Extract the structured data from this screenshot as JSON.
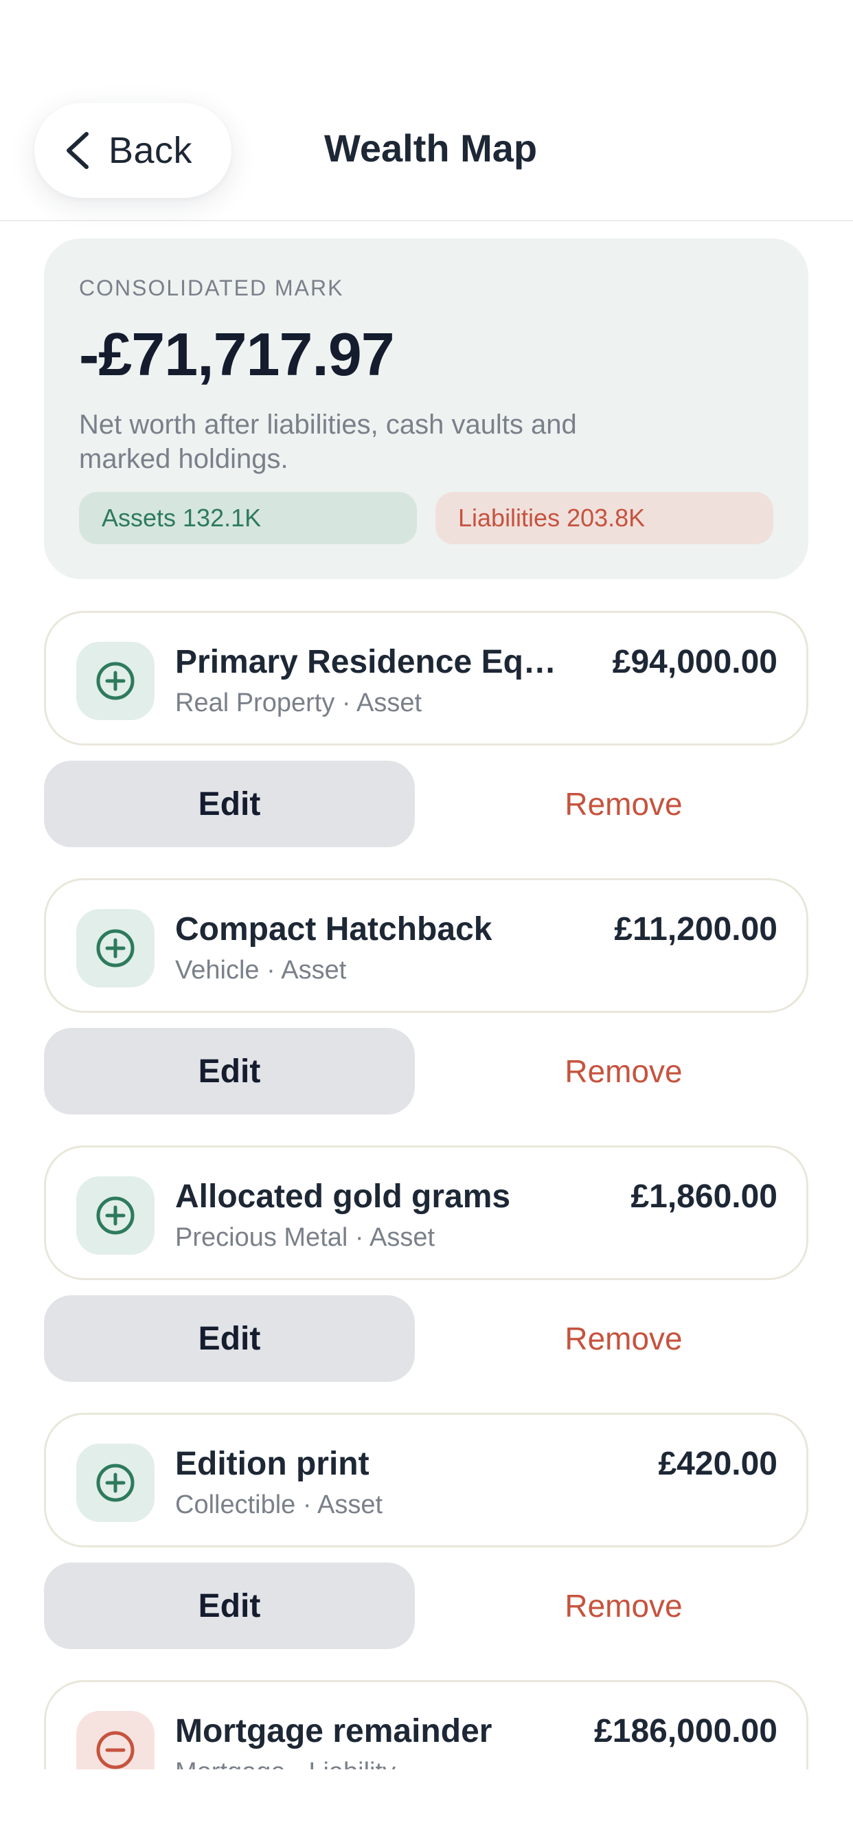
{
  "header": {
    "back_label": "Back",
    "title": "Wealth Map"
  },
  "summary": {
    "kicker": "CONSOLIDATED MARK",
    "amount": "-£71,717.97",
    "description": "Net worth after liabilities, cash vaults and marked holdings.",
    "assets_pill": "Assets 132.1K",
    "liabilities_pill": "Liabilities 203.8K"
  },
  "colors": {
    "asset_green": "#2e7a5d",
    "liability_red": "#c6533e",
    "ink": "#1d2735"
  },
  "actions": {
    "edit_label": "Edit",
    "remove_label": "Remove"
  },
  "holdings": [
    {
      "name": "Primary Residence Equ...",
      "category": "Real Property",
      "kind": "Asset",
      "value": "£94,000.00",
      "icon": "plus-circle-icon"
    },
    {
      "name": "Compact Hatchback",
      "category": "Vehicle",
      "kind": "Asset",
      "value": "£11,200.00",
      "icon": "plus-circle-icon"
    },
    {
      "name": "Allocated gold grams",
      "category": "Precious Metal",
      "kind": "Asset",
      "value": "£1,860.00",
      "icon": "plus-circle-icon"
    },
    {
      "name": "Edition print",
      "category": "Collectible",
      "kind": "Asset",
      "value": "£420.00",
      "icon": "plus-circle-icon"
    },
    {
      "name": "Mortgage remainder",
      "category": "Mortgage",
      "kind": "Liability",
      "value": "£186,000.00",
      "icon": "minus-circle-icon"
    }
  ]
}
